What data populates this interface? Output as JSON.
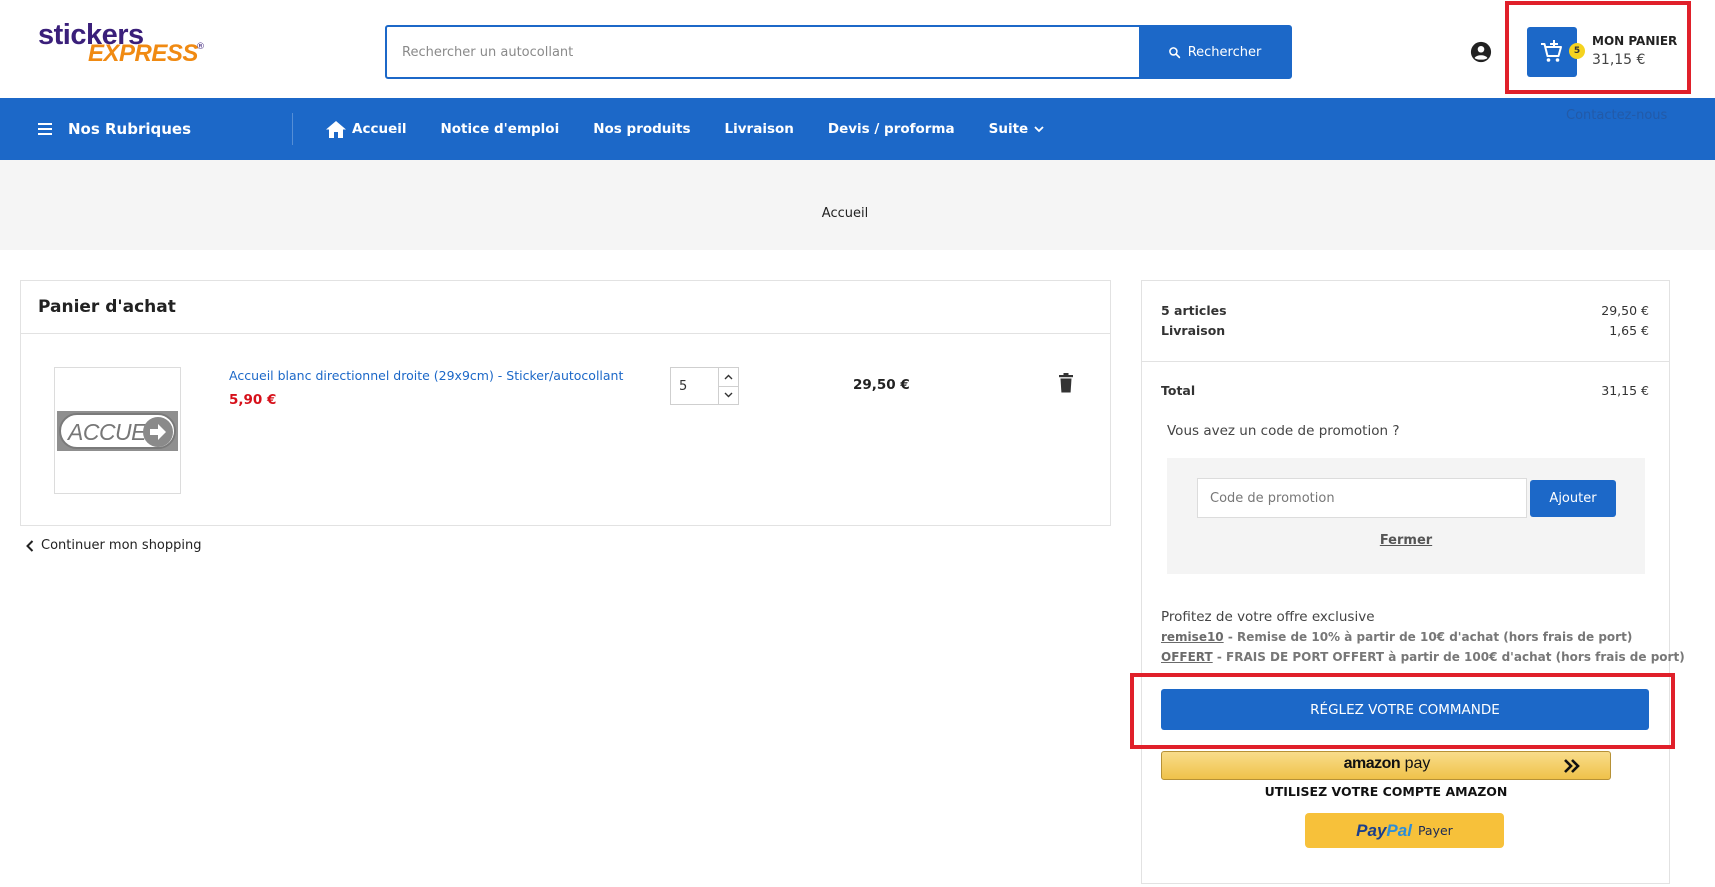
{
  "header": {
    "logo": {
      "line1": "stickers",
      "line2": "EXPRESS",
      "mark": "®"
    },
    "search": {
      "placeholder": "Rechercher un autocollant",
      "value": "",
      "button_label": "Rechercher"
    },
    "account_icon": "account-circle-icon",
    "cart": {
      "count": "5",
      "title": "MON PANIER",
      "total": "31,15 €"
    }
  },
  "nav": {
    "rubriques_label": "Nos Rubriques",
    "items": [
      {
        "label": "Accueil",
        "icon": "home-icon"
      },
      {
        "label": "Notice d'emploi"
      },
      {
        "label": "Nos produits"
      },
      {
        "label": "Livraison"
      },
      {
        "label": "Devis / proforma"
      },
      {
        "label": "Suite",
        "icon": "chevron-down-icon"
      }
    ],
    "contact_label": "Contactez-nous"
  },
  "breadcrumb": {
    "current": "Accueil"
  },
  "cart_panel": {
    "title": "Panier d'achat",
    "item": {
      "image_text": "ACCUEIL",
      "name": "Accueil blanc directionnel droite (29x9cm) - Sticker/autocollant",
      "unit_price": "5,90 €",
      "quantity": "5",
      "total": "29,50 €"
    },
    "continue_label": "Continuer mon shopping"
  },
  "summary": {
    "articles_label": "5 articles",
    "articles_value": "29,50 €",
    "shipping_label": "Livraison",
    "shipping_value": "1,65 €",
    "total_label": "Total",
    "total_value": "31,15 €",
    "promo_question": "Vous avez un code de promotion ?",
    "promo_placeholder": "Code de promotion",
    "promo_add_label": "Ajouter",
    "promo_close_label": "Fermer",
    "offer_title": "Profitez de votre offre exclusive",
    "offers": [
      {
        "code": "remise10",
        "text": " - Remise de 10% à partir de 10€ d'achat (hors frais de port)"
      },
      {
        "code": "OFFERT",
        "text": " - FRAIS DE PORT OFFERT à partir de 100€ d'achat (hors frais de port)"
      }
    ],
    "checkout_label": "RÉGLEZ VOTRE COMMANDE",
    "amazon_label_1": "amazon",
    "amazon_label_2": " pay",
    "amazon_caption": "UTILISEZ VOTRE COMPTE AMAZON",
    "paypal_logo_1": "Pay",
    "paypal_logo_2": "Pal",
    "paypal_label": "Payer"
  },
  "colors": {
    "primary": "#1c68c8",
    "price_red": "#d6101a",
    "highlight": "#e0202a",
    "badge": "#f5d31f",
    "amazon": "#efc24a",
    "paypal": "#f7c13a"
  }
}
